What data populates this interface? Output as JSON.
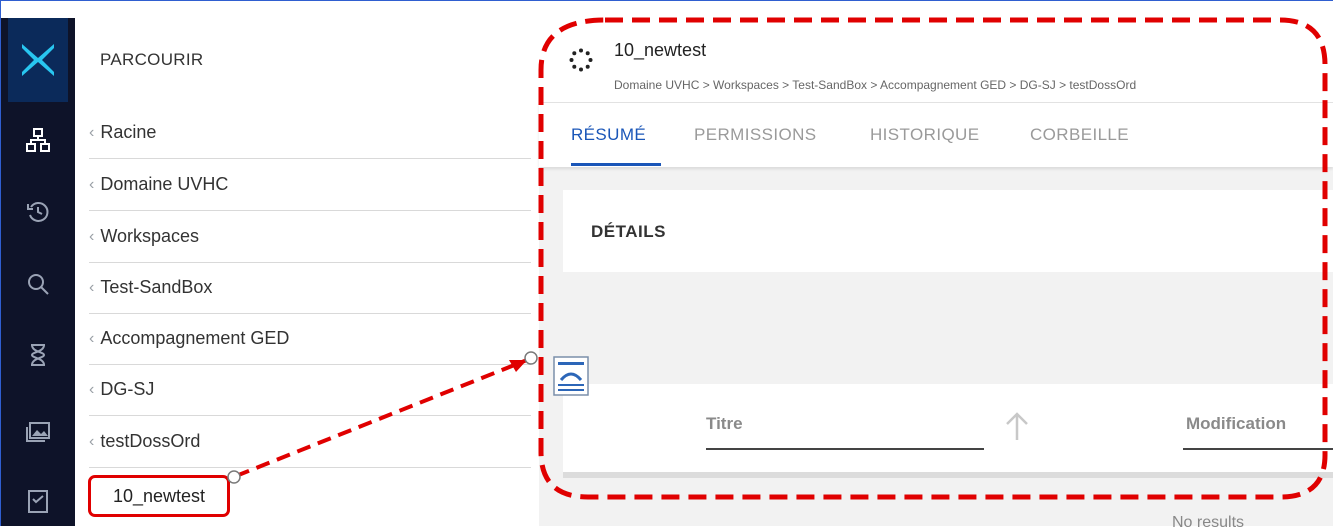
{
  "rail": {
    "logo_icon": "x-logo-icon",
    "items": [
      "browse-tree-icon",
      "history-icon",
      "search-icon",
      "hourglass-icon",
      "media-icon",
      "tasks-icon"
    ]
  },
  "browse": {
    "title": "PARCOURIR",
    "items": [
      {
        "label": "Racine"
      },
      {
        "label": "Domaine UVHC"
      },
      {
        "label": "Workspaces"
      },
      {
        "label": "Test-SandBox"
      },
      {
        "label": "Accompagnement GED"
      },
      {
        "label": "DG-SJ"
      },
      {
        "label": "testDossOrd"
      }
    ],
    "current": "10_newtest"
  },
  "document": {
    "title": "10_newtest",
    "breadcrumb": "Domaine UVHC > Workspaces > Test-SandBox > Accompagnement GED > DG-SJ > testDossOrd"
  },
  "tabs": [
    {
      "label": "RÉSUMÉ",
      "active": true
    },
    {
      "label": "PERMISSIONS",
      "active": false
    },
    {
      "label": "HISTORIQUE",
      "active": false
    },
    {
      "label": "CORBEILLE",
      "active": false
    }
  ],
  "details": {
    "title": "DÉTAILS"
  },
  "results": {
    "col_title": "Titre",
    "col_modification": "Modification",
    "empty_text": "No results"
  },
  "colors": {
    "rail_bg": "#0e1329",
    "accent_blue": "#1a56b8",
    "annotation_red": "#e00000",
    "logo_cyan": "#28c6f0"
  }
}
